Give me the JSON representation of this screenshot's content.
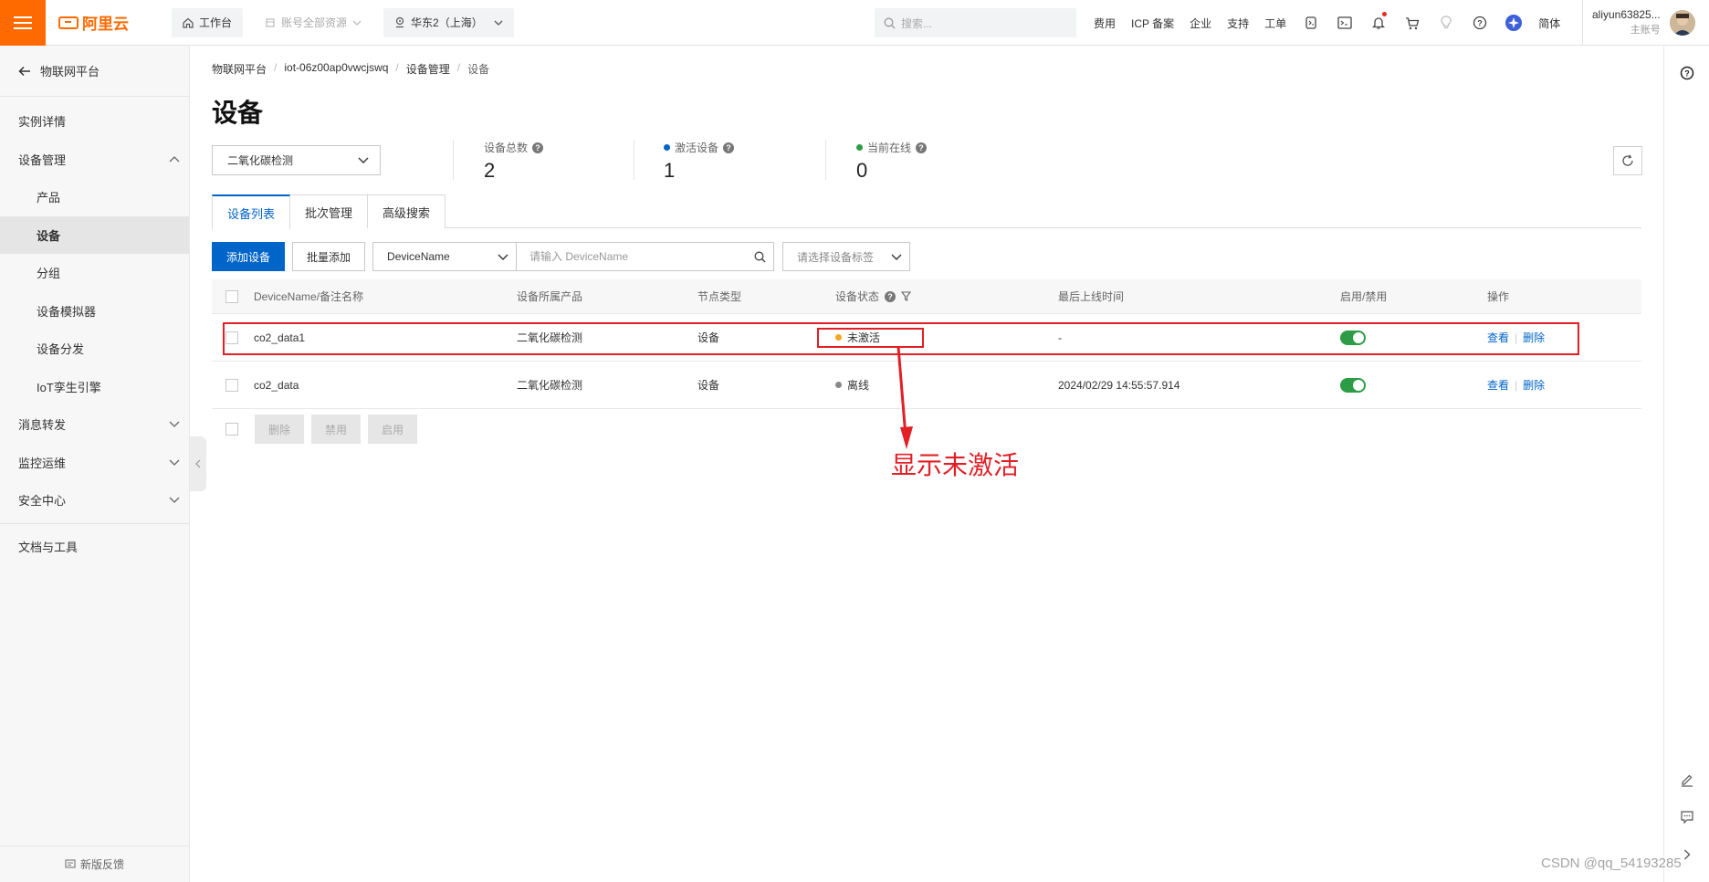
{
  "topbar": {
    "logo": "阿里云",
    "workbench": "工作台",
    "resources": "账号全部资源",
    "region": "华东2（上海）",
    "search_placeholder": "搜索...",
    "links": [
      "费用",
      "ICP 备案",
      "企业",
      "支持",
      "工单"
    ],
    "lang": "简体",
    "account_name": "aliyun63825...",
    "account_role": "主账号"
  },
  "sidebar": {
    "back_label": "物联网平台",
    "items": [
      {
        "label": "实例详情"
      },
      {
        "label": "设备管理"
      },
      {
        "label": "产品"
      },
      {
        "label": "设备"
      },
      {
        "label": "分组"
      },
      {
        "label": "设备模拟器"
      },
      {
        "label": "设备分发"
      },
      {
        "label": "IoT孪生引擎"
      },
      {
        "label": "消息转发"
      },
      {
        "label": "监控运维"
      },
      {
        "label": "安全中心"
      },
      {
        "label": "文档与工具"
      }
    ],
    "feedback": "新版反馈"
  },
  "breadcrumb": [
    "物联网平台",
    "iot-06z00ap0vwcjswq",
    "设备管理",
    "设备"
  ],
  "page_title": "设备",
  "product_select": "二氧化碳检测",
  "stats": [
    {
      "label": "设备总数",
      "value": "2",
      "dot_color": ""
    },
    {
      "label": "激活设备",
      "value": "1",
      "dot_color": "#0064c8"
    },
    {
      "label": "当前在线",
      "value": "0",
      "dot_color": "#2d9c46"
    }
  ],
  "tabs": [
    "设备列表",
    "批次管理",
    "高级搜索"
  ],
  "toolbar": {
    "add_device": "添加设备",
    "batch_add": "批量添加",
    "field_select": "DeviceName",
    "search_placeholder": "请输入 DeviceName",
    "tag_placeholder": "请选择设备标签"
  },
  "table": {
    "headers": [
      "DeviceName/备注名称",
      "设备所属产品",
      "节点类型",
      "设备状态",
      "最后上线时间",
      "启用/禁用",
      "操作"
    ],
    "rows": [
      {
        "name": "co2_data1",
        "product": "二氧化碳检测",
        "node_type": "设备",
        "status": "未激活",
        "status_color": "#f5a623",
        "last_online": "-",
        "enabled": true,
        "view": "查看",
        "delete": "删除"
      },
      {
        "name": "co2_data",
        "product": "二氧化碳检测",
        "node_type": "设备",
        "status": "离线",
        "status_color": "#888888",
        "last_online": "2024/02/29 14:55:57.914",
        "enabled": true,
        "view": "查看",
        "delete": "删除"
      }
    ]
  },
  "bulk_actions": [
    "删除",
    "禁用",
    "启用"
  ],
  "annotation": "显示未激活",
  "watermark": "CSDN @qq_54193285",
  "colors": {
    "brand_orange": "#ff6a00",
    "primary_blue": "#0064c8",
    "annotation_red": "#e21f26",
    "toggle_green": "#2d9c46"
  }
}
